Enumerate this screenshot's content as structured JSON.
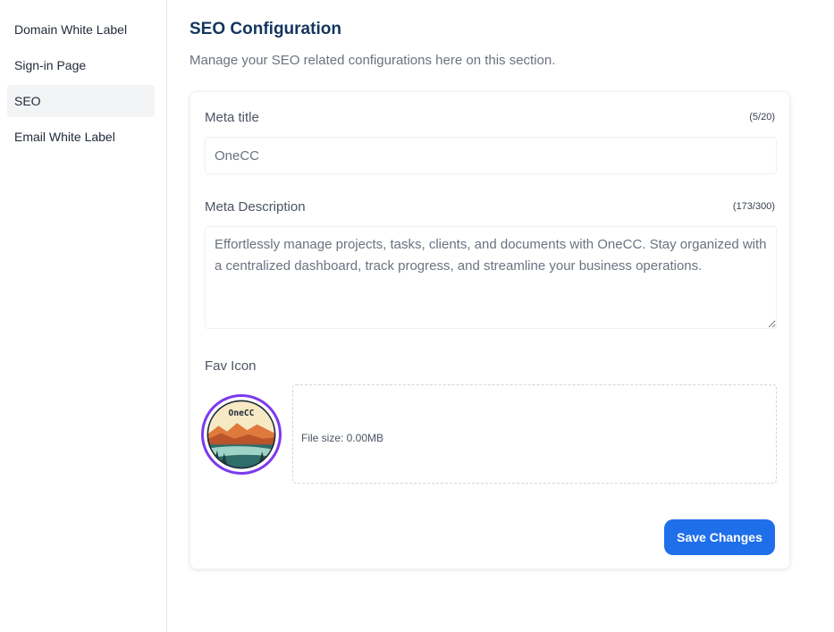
{
  "sidebar": {
    "items": [
      {
        "label": "Domain White Label"
      },
      {
        "label": "Sign-in Page"
      },
      {
        "label": "SEO"
      },
      {
        "label": "Email White Label"
      }
    ]
  },
  "header": {
    "title": "SEO Configuration",
    "subtitle": "Manage your SEO related configurations here on this section."
  },
  "form": {
    "meta_title": {
      "label": "Meta title",
      "counter": "(5/20)",
      "value": "OneCC"
    },
    "meta_description": {
      "label": "Meta Description",
      "counter": "(173/300)",
      "value": "Effortlessly manage projects, tasks, clients, and documents with OneCC. Stay organized with a centralized dashboard, track progress, and streamline your business operations."
    },
    "fav_icon": {
      "label": "Fav Icon",
      "logo_text": "OneCC",
      "file_size": "File size: 0.00MB"
    },
    "save_label": "Save Changes"
  },
  "colors": {
    "accent": "#1f6feb",
    "title": "#14365e",
    "fav_border": "#7c3aed"
  }
}
